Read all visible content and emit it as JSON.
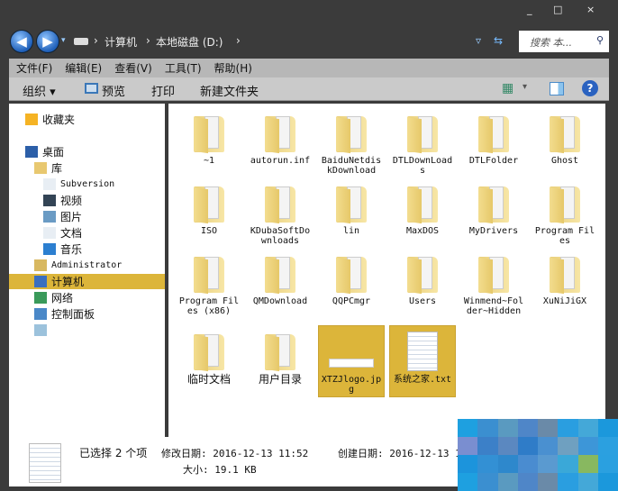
{
  "window": {
    "controls": [
      "_",
      "□",
      "×"
    ]
  },
  "address": {
    "breadcrumbs": [
      "计算机",
      "本地磁盘 (D:)"
    ],
    "search_placeholder": "搜索 本..."
  },
  "menu": [
    "文件(F)",
    "编辑(E)",
    "查看(V)",
    "工具(T)",
    "帮助(H)"
  ],
  "toolbar": {
    "organize": "组织 ▾",
    "preview": "预览",
    "print": "打印",
    "new_folder": "新建文件夹"
  },
  "sidebar": {
    "items": [
      {
        "label": "收藏夹",
        "icon": "star-icon"
      },
      {
        "label": "桌面",
        "icon": "desktop-icon"
      },
      {
        "label": "库",
        "icon": "library-icon"
      },
      {
        "label": "Subversion",
        "icon": "document-icon"
      },
      {
        "label": "视频",
        "icon": "video-icon"
      },
      {
        "label": "图片",
        "icon": "picture-icon"
      },
      {
        "label": "文档",
        "icon": "document-icon"
      },
      {
        "label": "音乐",
        "icon": "music-icon"
      },
      {
        "label": "Administrator",
        "icon": "user-folder-icon"
      },
      {
        "label": "计算机",
        "icon": "computer-icon",
        "selected": true
      },
      {
        "label": "网络",
        "icon": "network-icon"
      },
      {
        "label": "控制面板",
        "icon": "control-panel-icon"
      },
      {
        "label": "",
        "icon": "recycle-bin-icon"
      }
    ]
  },
  "files": [
    {
      "name": "~1",
      "type": "folder"
    },
    {
      "name": "autorun.inf",
      "type": "folder"
    },
    {
      "name": "BaiduNetdiskDownload",
      "type": "folder"
    },
    {
      "name": "DTLDownLoads",
      "type": "folder"
    },
    {
      "name": "DTLFolder",
      "type": "folder"
    },
    {
      "name": "Ghost",
      "type": "folder"
    },
    {
      "name": "ISO",
      "type": "folder"
    },
    {
      "name": "KDubaSoftDownloads",
      "type": "folder"
    },
    {
      "name": "lin",
      "type": "folder"
    },
    {
      "name": "MaxDOS",
      "type": "folder"
    },
    {
      "name": "MyDrivers",
      "type": "folder"
    },
    {
      "name": "Program Files",
      "type": "folder"
    },
    {
      "name": "Program Files (x86)",
      "type": "folder"
    },
    {
      "name": "QMDownload",
      "type": "folder"
    },
    {
      "name": "QQPCmgr",
      "type": "folder"
    },
    {
      "name": "Users",
      "type": "folder"
    },
    {
      "name": "Winmend~Folder~Hidden",
      "type": "folder"
    },
    {
      "name": "XuNiJiGX",
      "type": "folder"
    },
    {
      "name": "临时文档",
      "type": "folder"
    },
    {
      "name": "用户目录",
      "type": "folder"
    },
    {
      "name": "XTZJlogo.jpg",
      "type": "image",
      "selected": true
    },
    {
      "name": "系统之家.txt",
      "type": "text",
      "selected": true
    }
  ],
  "status": {
    "selected": "已选择 2 个项",
    "modified": "修改日期: 2016-12-13 11:52",
    "created": "创建日期: 2016-12-13 1",
    "size": "大小: 19.1 KB"
  },
  "colors": {
    "selection": "#dcb53a",
    "frame": "#3b3b3b"
  }
}
